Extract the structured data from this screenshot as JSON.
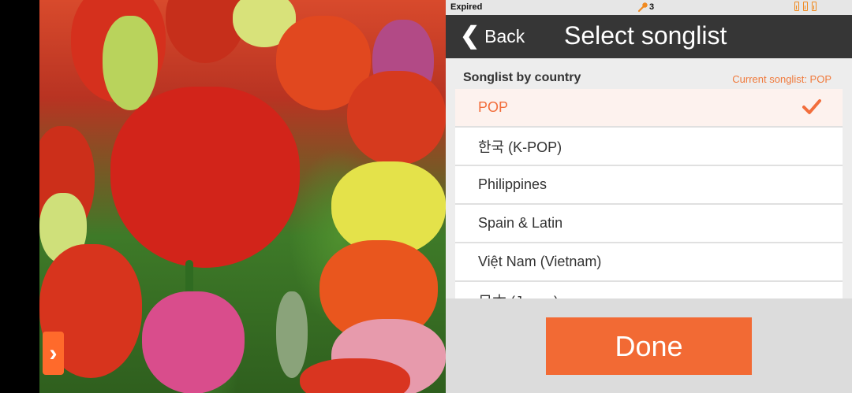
{
  "status_bar": {
    "expired_text": "Expired",
    "mic_count": "3",
    "mic_icon": "microphone-icon",
    "battery_icon": "battery-icon"
  },
  "header": {
    "back_label": "Back",
    "back_icon": "chevron-left-icon",
    "title": "Select songlist"
  },
  "section": {
    "label": "Songlist by country",
    "current_songlist": "Current songlist: POP"
  },
  "songlists": [
    {
      "label": "POP",
      "selected": true
    },
    {
      "label": "한국 (K-POP)",
      "selected": false
    },
    {
      "label": "Philippines",
      "selected": false
    },
    {
      "label": "Spain & Latin",
      "selected": false
    },
    {
      "label": "Việt Nam (Vietnam)",
      "selected": false
    },
    {
      "label": "日本 (Japan)",
      "selected": false
    }
  ],
  "footer": {
    "done_label": "Done"
  },
  "photo": {
    "next_glyph": "›",
    "next_icon": "chevron-right-icon"
  },
  "colors": {
    "accent": "#f26a34",
    "header_bg": "#363636",
    "selected_text": "#f26e3c"
  }
}
